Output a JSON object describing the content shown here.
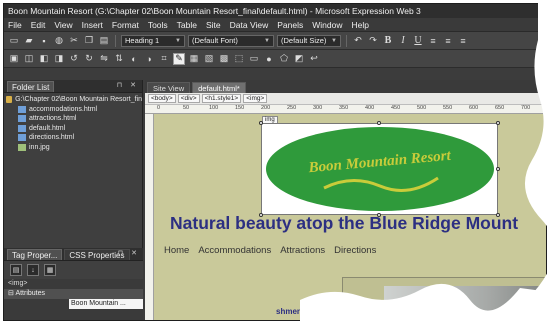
{
  "window": {
    "title": "Boon Mountain Resort (G:\\Chapter 02\\Boon Mountain Resort_final\\default.html) - Microsoft Expression Web 3"
  },
  "menu": [
    "File",
    "Edit",
    "View",
    "Insert",
    "Format",
    "Tools",
    "Table",
    "Site",
    "Data View",
    "Panels",
    "Window",
    "Help"
  ],
  "toolbar": {
    "style_value": "Heading 1",
    "font_value": "(Default Font)",
    "size_value": "(Default Size)"
  },
  "folder_panel": {
    "title": "Folder List",
    "root": "G:\\Chapter 02\\Boon Mountain Resort_fin",
    "files": [
      "accommodations.html",
      "attractions.html",
      "default.html",
      "directions.html",
      "inn.jpg"
    ]
  },
  "tag_panel": {
    "tab_tag": "Tag Proper...",
    "tab_css": "CSS Properties",
    "current_tag": "<img>",
    "section": "Attributes",
    "alt_value": "Boon Mountain ..."
  },
  "editor": {
    "tabs": [
      "Site View",
      "default.html*"
    ],
    "breadcrumbs": [
      "<body>",
      "<div>",
      "<h1.style1>",
      "<img>"
    ],
    "ruler_marks": [
      "0",
      "50",
      "100",
      "150",
      "200",
      "250",
      "300",
      "350",
      "400",
      "450",
      "500",
      "550",
      "600",
      "650",
      "700"
    ],
    "img_tag_label": "img",
    "logo_text": "Boon Mountain Resort",
    "heading": "Natural beauty atop the Blue Ridge Mount",
    "nav_links": [
      "Home",
      "Accommodations",
      "Attractions",
      "Directions"
    ],
    "lower_text": "shment. Rep"
  },
  "colors": {
    "logo_green": "#2f9a3b",
    "logo_text": "#c9cc3a",
    "heading_blue": "#2c2f82",
    "canvas_bg": "#c9c99a"
  }
}
